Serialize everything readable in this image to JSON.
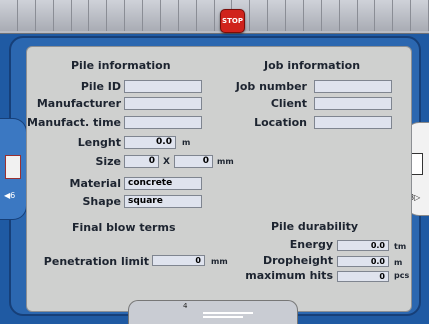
{
  "toolbar": {
    "stop_label": "STOP"
  },
  "nav": {
    "left_arrow": "◀6",
    "right_arrow": "8▷",
    "bottom_count": "4"
  },
  "pile_info": {
    "heading": "Pile information",
    "pile_id_label": "Pile ID",
    "pile_id_value": "",
    "manufacturer_label": "Manufacturer",
    "manufacturer_value": "",
    "manufact_time_label": "Manufact. time",
    "manufact_time_value": "",
    "length_label": "Lenght",
    "length_value": "0.0",
    "length_unit": "m",
    "size_label": "Size",
    "size_x_value": "0",
    "size_sep": "X",
    "size_y_value": "0",
    "size_unit": "mm",
    "material_label": "Material",
    "material_value": "concrete",
    "shape_label": "Shape",
    "shape_value": "square"
  },
  "job_info": {
    "heading": "Job information",
    "job_number_label": "Job number",
    "job_number_value": "",
    "client_label": "Client",
    "client_value": "",
    "location_label": "Location",
    "location_value": ""
  },
  "final_blow": {
    "heading": "Final blow terms",
    "penetration_label": "Penetration limit",
    "penetration_value": "0",
    "penetration_unit": "mm"
  },
  "durability": {
    "heading": "Pile durability",
    "energy_label": "Energy",
    "energy_value": "0.0",
    "energy_unit": "tm",
    "dropheight_label": "Dropheight",
    "dropheight_value": "0.0",
    "dropheight_unit": "m",
    "max_hits_label": "maximum hits",
    "max_hits_value": "0",
    "max_hits_unit": "pcs"
  },
  "colors": {
    "frame": "#2b67b0",
    "panel": "#cfd0cf",
    "field": "#dfe3ee",
    "stop": "#d0231c"
  }
}
